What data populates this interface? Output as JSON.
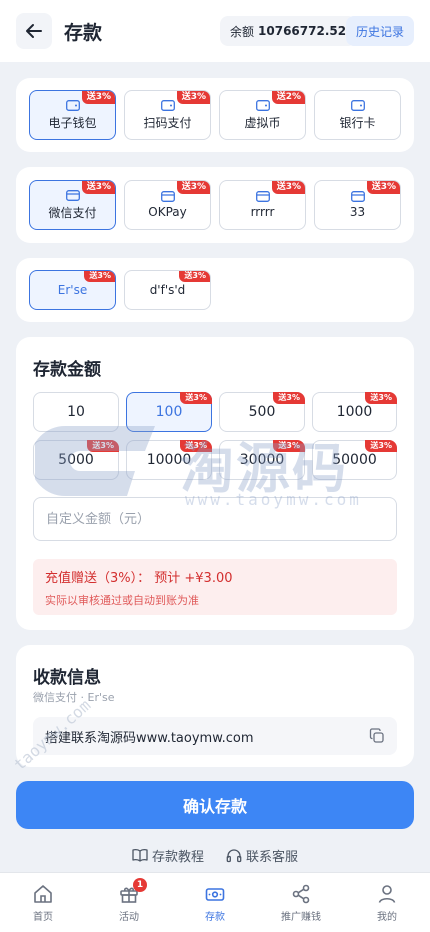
{
  "header": {
    "title": "存款",
    "balance_label": "余额",
    "balance_value": "10766772.52",
    "history_label": "历史记录"
  },
  "methods": [
    {
      "label": "电子钱包",
      "badge": "送3%",
      "selected": true
    },
    {
      "label": "扫码支付",
      "badge": "送3%",
      "selected": false
    },
    {
      "label": "虚拟币",
      "badge": "送2%",
      "selected": false
    },
    {
      "label": "银行卡",
      "badge": "",
      "selected": false
    }
  ],
  "channels": [
    {
      "label": "微信支付",
      "badge": "送3%",
      "selected": true
    },
    {
      "label": "OKPay",
      "badge": "送3%",
      "selected": false
    },
    {
      "label": "rrrrr",
      "badge": "送3%",
      "selected": false
    },
    {
      "label": "33",
      "badge": "送3%",
      "selected": false
    }
  ],
  "accounts": [
    {
      "label": "Er'se",
      "badge": "送3%",
      "selected": true
    },
    {
      "label": "d'f's'd",
      "badge": "送3%",
      "selected": false
    }
  ],
  "amount_section": {
    "title": "存款金额",
    "amounts": [
      {
        "value": "10",
        "badge": "",
        "selected": false
      },
      {
        "value": "100",
        "badge": "送3%",
        "selected": true
      },
      {
        "value": "500",
        "badge": "送3%",
        "selected": false
      },
      {
        "value": "1000",
        "badge": "送3%",
        "selected": false
      },
      {
        "value": "5000",
        "badge": "送3%",
        "selected": false
      },
      {
        "value": "10000",
        "badge": "送3%",
        "selected": false
      },
      {
        "value": "30000",
        "badge": "送3%",
        "selected": false
      },
      {
        "value": "50000",
        "badge": "送3%",
        "selected": false
      }
    ],
    "custom_placeholder": "自定义金额（元）",
    "bonus_main": "充值赠送（3%）：   预计 +¥3.00",
    "bonus_note": "实际以审核通过或自动到账为准"
  },
  "receive_section": {
    "title": "收款信息",
    "subtitle": "微信支付 · Er'se",
    "info": "搭建联系淘源码www.taoymw.com"
  },
  "confirm_label": "确认存款",
  "help": {
    "tutorial": "存款教程",
    "support": "联系客服"
  },
  "tabs": [
    {
      "label": "首页",
      "icon": "home-icon",
      "badge": "",
      "active": false
    },
    {
      "label": "活动",
      "icon": "gift-icon",
      "badge": "1",
      "active": false
    },
    {
      "label": "存款",
      "icon": "wallet-icon",
      "badge": "",
      "active": true
    },
    {
      "label": "推广赚钱",
      "icon": "share-icon",
      "badge": "",
      "active": false
    },
    {
      "label": "我的",
      "icon": "user-icon",
      "badge": "",
      "active": false
    }
  ],
  "watermark": {
    "brand": "淘源码",
    "url": "www.taoymw.com",
    "diag": "taoymw.com"
  },
  "colors": {
    "accent": "#3c74e0",
    "button": "#3d86f5",
    "badge": "#e53935",
    "bonus_bg": "#fdeeee"
  }
}
